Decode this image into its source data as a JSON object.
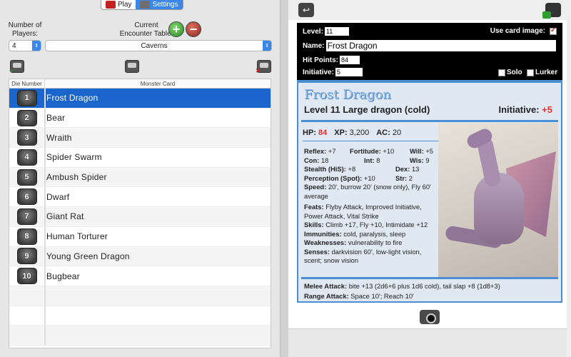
{
  "tabs": {
    "play": "Play",
    "settings": "Settings"
  },
  "settings": {
    "players_label": "Number of\nPlayers:",
    "players_value": "4",
    "encounter_label": "Current\nEncounter Table:",
    "encounter_value": "Caverns"
  },
  "table": {
    "col_die": "Die Number",
    "col_card": "Monster Card",
    "rows": [
      {
        "die": "1",
        "name": "Frost Dragon"
      },
      {
        "die": "2",
        "name": "Bear"
      },
      {
        "die": "3",
        "name": "Wraith"
      },
      {
        "die": "4",
        "name": "Spider Swarm"
      },
      {
        "die": "5",
        "name": "Ambush Spider"
      },
      {
        "die": "6",
        "name": "Dwarf"
      },
      {
        "die": "7",
        "name": "Giant Rat"
      },
      {
        "die": "8",
        "name": "Human Torturer"
      },
      {
        "die": "9",
        "name": "Young Green Dragon"
      },
      {
        "die": "10",
        "name": "Bugbear"
      }
    ],
    "selected_index": 0
  },
  "editor": {
    "level_label": "Level:",
    "level_value": "11",
    "name_label": "Name:",
    "name_value": "Frost Dragon",
    "hp_label": "Hit Points:",
    "hp_value": "84",
    "init_label": "Initiative:",
    "init_value": "5",
    "use_image_label": "Use card image:",
    "solo_label": "Solo",
    "lurker_label": "Lurker",
    "use_image_checked": true
  },
  "card": {
    "name": "Frost Dragon",
    "line": "Level 11 Large dragon (cold)",
    "init_label": "Initiative:",
    "init_value": "+5",
    "hp_label": "HP:",
    "hp_value": "84",
    "xp_label": "XP:",
    "xp_value": "3,200",
    "ac_label": "AC:",
    "ac_value": "20",
    "reflex_label": "Reflex:",
    "reflex_value": "+7",
    "fort_label": "Fortitude:",
    "fort_value": "+10",
    "will_label": "Will:",
    "will_value": "+5",
    "con_label": "Con:",
    "con_value": "18",
    "int_label": "Int:",
    "int_value": "8",
    "wis_label": "Wis:",
    "wis_value": "9",
    "stealth_label": "Stealth (HiS):",
    "stealth_value": "+8",
    "dex_label": "Dex:",
    "dex_value": "13",
    "perception_label": "Perception (Spot):",
    "perception_value": "+10",
    "str_label": "Str:",
    "str_value": "2",
    "speed_label": "Speed:",
    "speed_value": "20', burrow 20' (snow only), Fly 60' average",
    "feats_label": "Feats:",
    "feats_value": "Flyby Attack, Improved Initiative, Power Attack, Vital Strike",
    "skills_label": "Skills:",
    "skills_value": "Climb +17, Fly +10, Intimidate +12",
    "immunities_label": "Immunities:",
    "immunities_value": "cold, paralysis, sleep",
    "weak_label": "Weaknesses:",
    "weak_value": "vulnerability to fire",
    "senses_label": "Senses:",
    "senses_value": "darkvision 60', low-light vision, scent; snow vision",
    "melee_label": "Melee Attack:",
    "melee_value": "bite +13 (2d6+6 plus 1d6 cold), tail slap +8 (1d8+3)",
    "range_label": "Range Attack:",
    "range_value": "Space 10'; Reach 10'"
  },
  "colors": {
    "accent": "#3b86ea",
    "selected_row": "#1b66cc",
    "card_border": "#4a8fd1",
    "hp_red": "#dd3333"
  },
  "icons": [
    "dice-icon",
    "gears-icon",
    "plus-icon",
    "minus-icon",
    "chest-add-icon",
    "chest-random-icon",
    "chest-remove-icon",
    "back-icon",
    "export-icon",
    "camera-icon"
  ]
}
